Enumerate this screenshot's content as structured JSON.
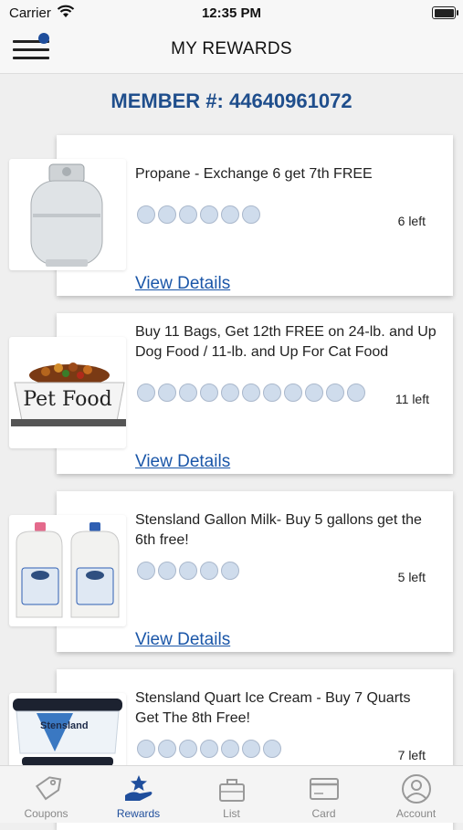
{
  "status_bar": {
    "carrier": "Carrier",
    "time": "12:35 PM"
  },
  "header": {
    "title": "MY REWARDS"
  },
  "member_line": "MEMBER #: 44640961072",
  "rewards": [
    {
      "description": "Propane - Exchange 6 get 7th FREE",
      "punches_total": 6,
      "remaining": "6 left",
      "link": "View Details",
      "image": "propane-tank"
    },
    {
      "description": "Buy 11 Bags, Get 12th FREE on 24-lb. and Up Dog Food / 11-lb. and Up For Cat Food",
      "punches_total": 11,
      "remaining": "11 left",
      "link": "View Details",
      "image": "pet-food-bowl",
      "image_label": "Pet Food"
    },
    {
      "description": "Stensland Gallon Milk- Buy 5 gallons get the 6th free!",
      "punches_total": 5,
      "remaining": "5 left",
      "link": "View Details",
      "image": "milk-jugs"
    },
    {
      "description": "Stensland Quart Ice Cream - Buy 7 Quarts Get The 8th Free!",
      "punches_total": 7,
      "remaining": "7 left",
      "link": "View Details",
      "image": "ice-cream-tub",
      "image_label": "Stensland"
    }
  ],
  "tabs": [
    {
      "label": "Coupons",
      "icon": "coupon-tag-icon",
      "active": false
    },
    {
      "label": "Rewards",
      "icon": "rewards-star-hand-icon",
      "active": true
    },
    {
      "label": "List",
      "icon": "list-bag-icon",
      "active": false
    },
    {
      "label": "Card",
      "icon": "card-icon",
      "active": false
    },
    {
      "label": "Account",
      "icon": "account-person-icon",
      "active": false
    }
  ],
  "colors": {
    "accent": "#1f4e9c",
    "member_text": "#1f4e8c",
    "link": "#1a56a8",
    "punch_fill": "#cfdcec"
  }
}
